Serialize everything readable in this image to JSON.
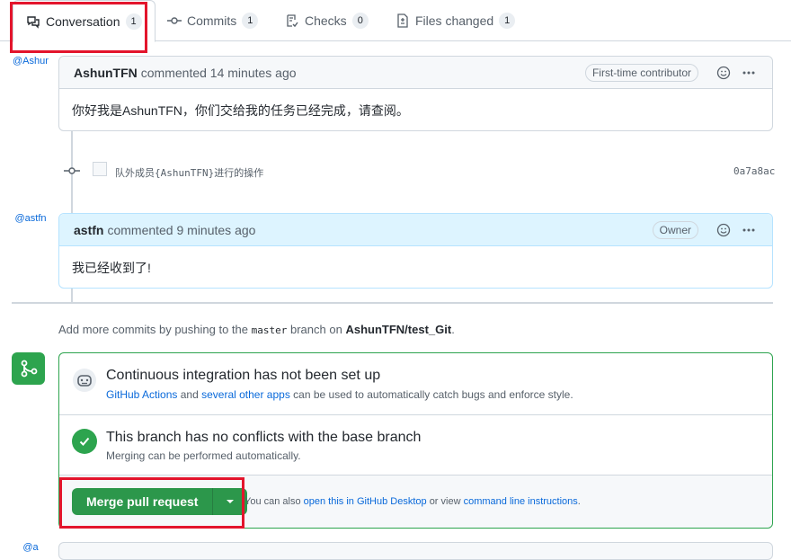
{
  "tabs": [
    {
      "label": "Conversation",
      "count": "1",
      "icon": "comment-discussion-icon",
      "selected": true
    },
    {
      "label": "Commits",
      "count": "1",
      "icon": "git-commit-icon"
    },
    {
      "label": "Checks",
      "count": "0",
      "icon": "checklist-icon"
    },
    {
      "label": "Files changed",
      "count": "1",
      "icon": "file-diff-icon"
    }
  ],
  "comments": [
    {
      "avatar_alt": "@AshunTFN",
      "author": "AshunTFN",
      "meta": "commented 14 minutes ago",
      "badge": "First-time contributor",
      "body": "你好我是AshunTFN，你们交给我的任务已经完成，请查阅。"
    },
    {
      "avatar_alt": "@astfn",
      "author": "astfn",
      "meta": "commented 9 minutes ago",
      "badge": "Owner",
      "body": "我已经收到了!"
    }
  ],
  "commit": {
    "message": "队外成员{AshunTFN}进行的操作",
    "sha": "0a7a8ac"
  },
  "info": {
    "prefix": "Add more commits by pushing to the",
    "branch": "master",
    "middle": "branch on",
    "repo": "AshunTFN/test_Git",
    "suffix": "."
  },
  "merge": {
    "ci_title": "Continuous integration has not been set up",
    "ci_link1": "GitHub Actions",
    "ci_and": "and",
    "ci_link2": "several other apps",
    "ci_rest": "can be used to automatically catch bugs and enforce style.",
    "conflict_title": "This branch has no conflicts with the base branch",
    "conflict_sub": "Merging can be performed automatically.",
    "button_label": "Merge pull request",
    "hint_prefix": "You can also",
    "hint_link1": "open this in GitHub Desktop",
    "hint_mid": "or view",
    "hint_link2": "command line instructions",
    "hint_suffix": "."
  },
  "bottom_avatar_alt": "@a",
  "colors": {
    "highlight": "#e3152c",
    "green": "#2da44e",
    "link": "#0969da"
  }
}
